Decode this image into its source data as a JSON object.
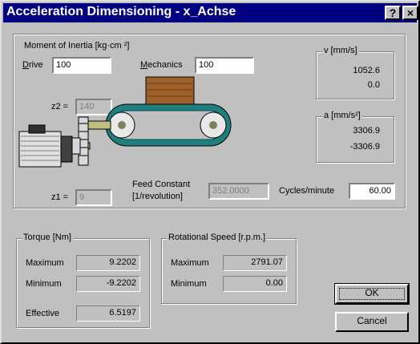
{
  "window": {
    "title": "Acceleration Dimensioning - x_Achse",
    "help_button": "?",
    "close_button": "×"
  },
  "inertia": {
    "group_label": "Moment of Inertia [kg·cm ²]",
    "drive_label": "Drive",
    "drive_hotkey": "D",
    "drive_value": "100",
    "mechanics_label": "Mechanics",
    "mechanics_hotkey": "M",
    "mechanics_value": "100"
  },
  "gear": {
    "z2_label": "z2 =",
    "z2_value": "140",
    "z1_label": "z1 =",
    "z1_value": "9"
  },
  "feed": {
    "label_line1": "Feed Constant",
    "label_line2": "[1/revolution]",
    "value": "352.0000"
  },
  "cycles": {
    "label": "Cycles/minute",
    "value": "60.00"
  },
  "velocity": {
    "label": "v [mm/s]",
    "max": "1052.6",
    "min": "0.0"
  },
  "acceleration": {
    "label": "a [mm/s²]",
    "max": "3306.9",
    "min": "-3306.9"
  },
  "torque": {
    "group_label": "Torque [Nm]",
    "max_label": "Maximum",
    "max_value": "9.2202",
    "min_label": "Minimum",
    "min_value": "-9.2202",
    "eff_label": "Effective",
    "eff_value": "6.5197"
  },
  "speed": {
    "group_label": "Rotational Speed [r.p.m.]",
    "max_label": "Maximum",
    "max_value": "2791.07",
    "min_label": "Minimum",
    "min_value": "0.00"
  },
  "buttons": {
    "ok": "OK",
    "cancel": "Cancel"
  },
  "colors": {
    "title_bar": "#000080",
    "belt": "#1f7f7f",
    "load_box": "#a0622d"
  }
}
